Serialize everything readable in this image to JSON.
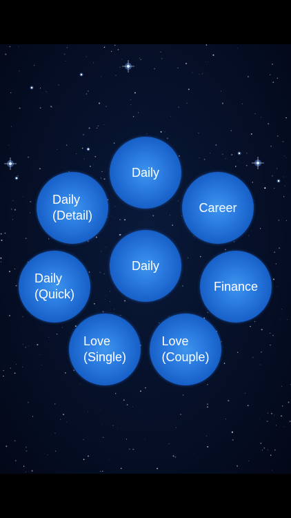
{
  "colors": {
    "background": "#000000",
    "sky": "#06112a",
    "bubble": "#2a7ae0",
    "label": "#ffffff"
  },
  "menu": {
    "daily_top": "Daily",
    "career": "Career",
    "daily_detail": "Daily\n(Detail)",
    "daily_center": "Daily",
    "finance": "Finance",
    "daily_quick": "Daily\n(Quick)",
    "love_single": "Love\n(Single)",
    "love_couple": "Love\n(Couple)"
  }
}
